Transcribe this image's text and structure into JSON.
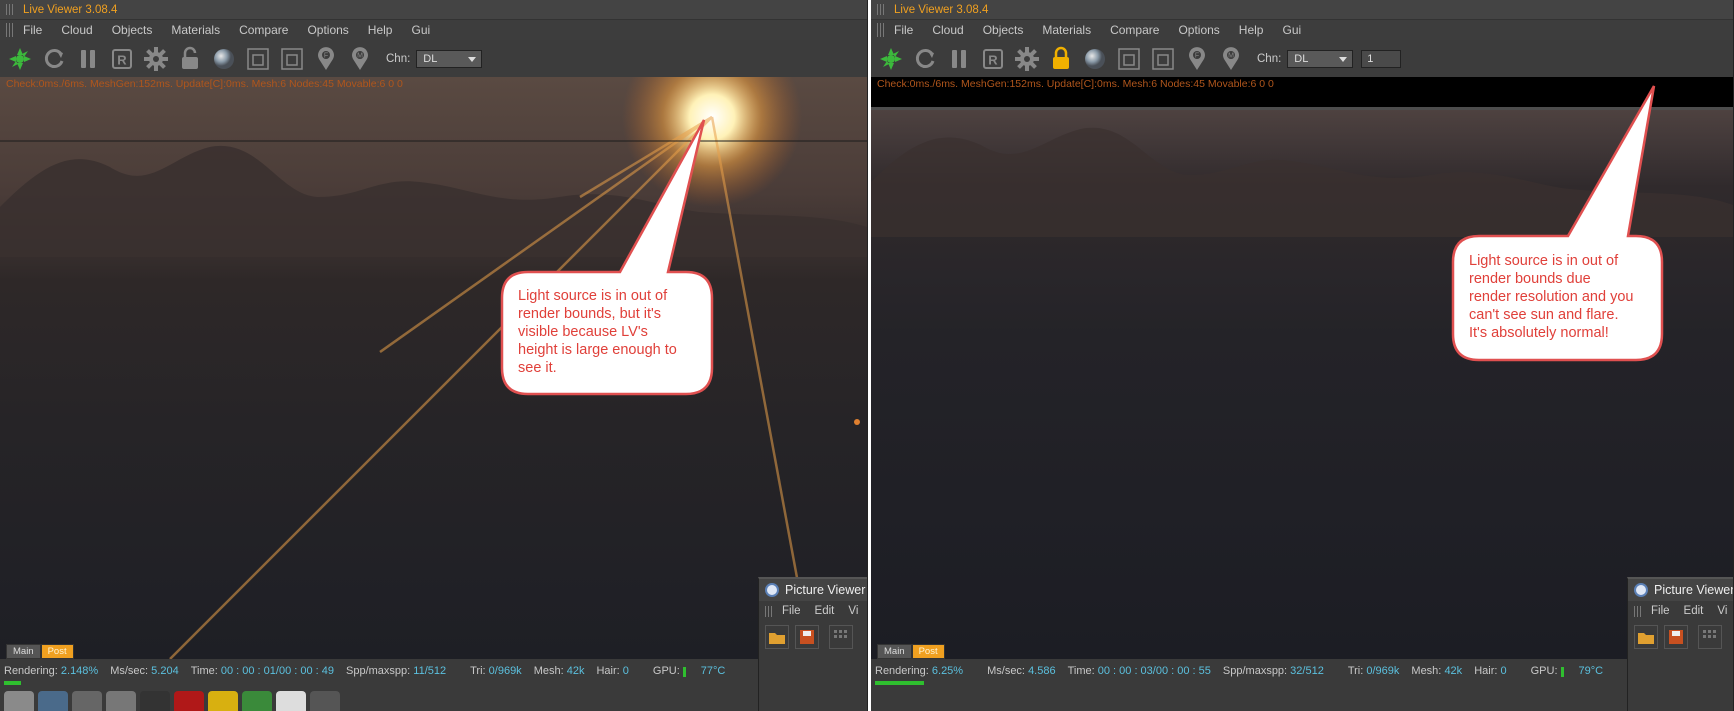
{
  "left": {
    "title": "Live Viewer 3.08.4",
    "menu": [
      "File",
      "Cloud",
      "Objects",
      "Materials",
      "Compare",
      "Options",
      "Help",
      "Gui"
    ],
    "chn_label": "Chn:",
    "chn_value": "DL",
    "stats": "Check:0ms./6ms. MeshGen:152ms. Update[C]:0ms. Mesh:6 Nodes:45 Movable:6  0 0",
    "tabs": [
      "Main",
      "Post"
    ],
    "status": {
      "rendering_label": "Rendering:",
      "rendering": "2.148%",
      "mssec_label": "Ms/sec:",
      "mssec": "5.204",
      "time_label": "Time:",
      "time": "00 : 00 : 01/00 : 00 : 49",
      "spp_label": "Spp/maxspp:",
      "spp": "11/512",
      "tri_label": "Tri:",
      "tri": "0/969k",
      "mesh_label": "Mesh:",
      "mesh": "42k",
      "hair_label": "Hair:",
      "hair": "0",
      "gpu_label": "GPU:",
      "temp": "77°C"
    },
    "progress": 0.0215,
    "picture_viewer": {
      "title": "Picture Viewer",
      "menu": [
        "File",
        "Edit",
        "Vi"
      ]
    },
    "annotation": [
      "Light source is in out of",
      "render bounds, but it's",
      "visible because LV's",
      "height is large enough to",
      "see it."
    ]
  },
  "right": {
    "title": "Live Viewer 3.08.4",
    "menu": [
      "File",
      "Cloud",
      "Objects",
      "Materials",
      "Compare",
      "Options",
      "Help",
      "Gui"
    ],
    "chn_label": "Chn:",
    "chn_value": "DL",
    "num_value": "1",
    "stats": "Check:0ms./6ms. MeshGen:152ms. Update[C]:0ms. Mesh:6 Nodes:45 Movable:6  0 0",
    "tabs": [
      "Main",
      "Post"
    ],
    "status": {
      "rendering_label": "Rendering:",
      "rendering": "6.25%",
      "mssec_label": "Ms/sec:",
      "mssec": "4.586",
      "time_label": "Time:",
      "time": "00 : 00 : 03/00 : 00 : 55",
      "spp_label": "Spp/maxspp:",
      "spp": "32/512",
      "tri_label": "Tri:",
      "tri": "0/969k",
      "mesh_label": "Mesh:",
      "mesh": "42k",
      "hair_label": "Hair:",
      "hair": "0",
      "gpu_label": "GPU:",
      "temp": "79°C"
    },
    "progress": 0.0625,
    "picture_viewer": {
      "title": "Picture Viewer",
      "menu": [
        "File",
        "Edit",
        "Vi"
      ]
    },
    "annotation": [
      "Light source is in out of",
      "render bounds due",
      "render resolution and you",
      "can't see sun and flare.",
      "It's absolutely normal!"
    ]
  },
  "colors": {
    "title_accent": "#f0a020",
    "status_value": "#5bc0de",
    "progress": "#2fbf2f",
    "annotation": "#e0403a"
  },
  "icons": [
    "octane-logo-icon",
    "refresh-icon",
    "pause-icon",
    "r-icon",
    "gear-icon",
    "lock-icon",
    "material-sphere-icon",
    "region-icon",
    "region-alt-icon",
    "focus-pin-icon",
    "material-pin-icon"
  ]
}
